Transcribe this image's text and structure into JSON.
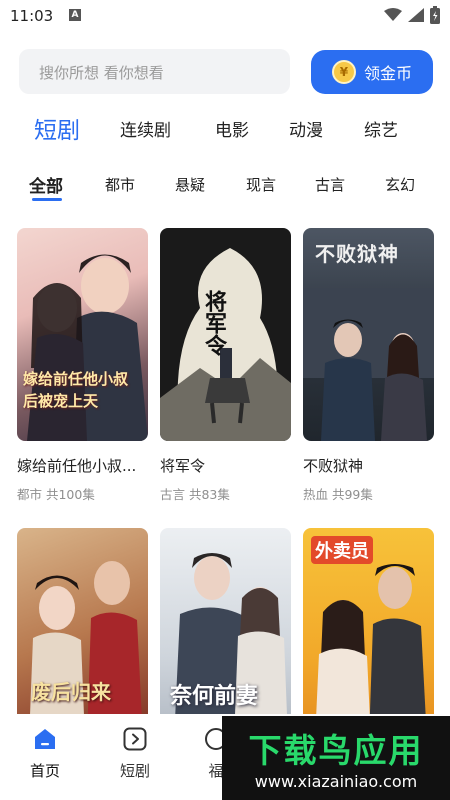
{
  "status": {
    "time": "11:03",
    "notice": "A"
  },
  "search": {
    "placeholder": "搜你所想 看你想看"
  },
  "gold_button": {
    "label": "领金币",
    "coin_symbol": "¥"
  },
  "main_tabs": [
    "短剧",
    "连续剧",
    "电影",
    "动漫",
    "综艺"
  ],
  "sub_tabs": [
    "全部",
    "都市",
    "悬疑",
    "现言",
    "古言",
    "玄幻"
  ],
  "cards": [
    {
      "title": "嫁给前任他小叔...",
      "meta": "都市  共100集",
      "poster_text": "嫁给前任他小叔 后被宠上天"
    },
    {
      "title": "将军令",
      "meta": "古言  共83集",
      "poster_text": "将军令"
    },
    {
      "title": "不败狱神",
      "meta": "热血  共99集",
      "poster_text": "不败狱神"
    },
    {
      "poster_text": "废后归来"
    },
    {
      "poster_text": "奈何前妻"
    },
    {
      "poster_text": "外卖员"
    }
  ],
  "bottom_nav": [
    "首页",
    "短剧",
    "福"
  ],
  "watermark": {
    "big": "下载鸟应用",
    "url": "www.xiazainiao.com"
  },
  "colors": {
    "accent": "#2b6ef1",
    "watermark_green": "#29d96b"
  }
}
